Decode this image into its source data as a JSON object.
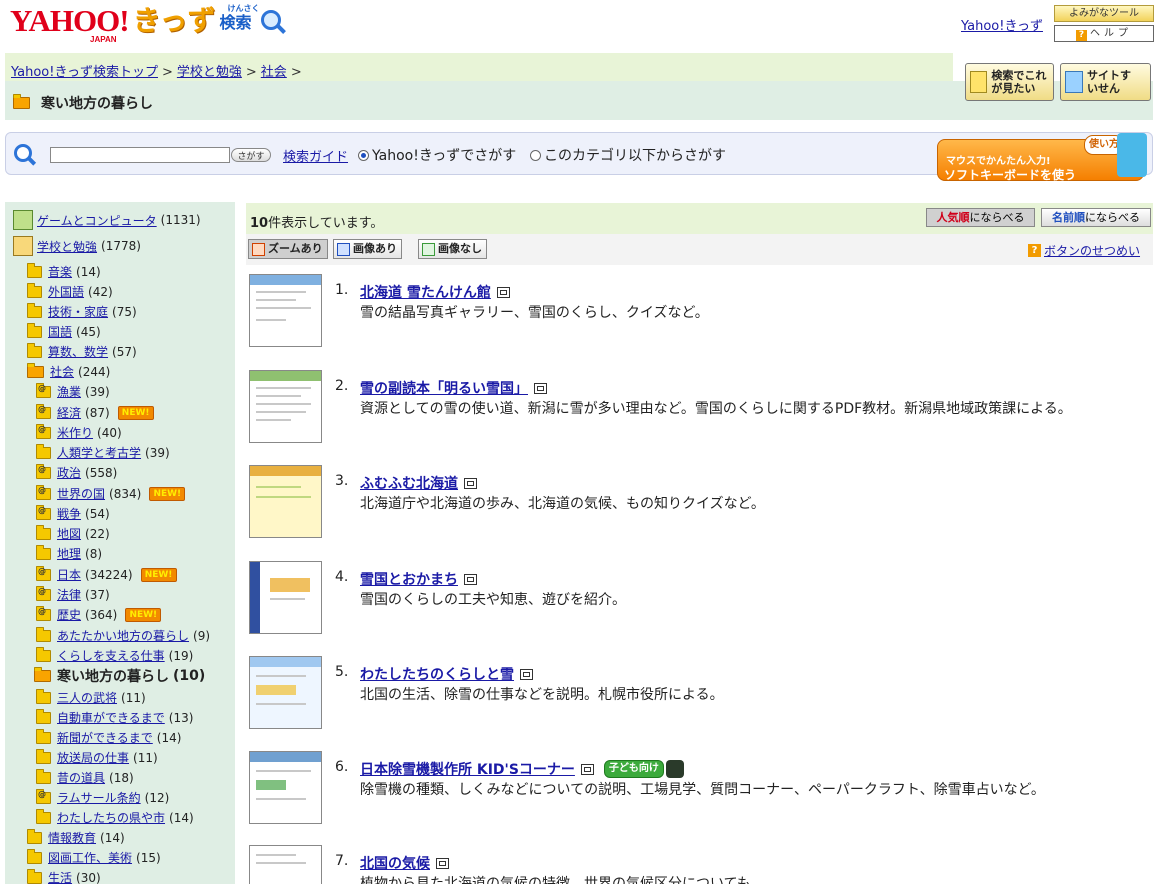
{
  "header": {
    "logo_yahoo": "YAHOO!",
    "logo_japan": "JAPAN",
    "logo_kids": "きっず",
    "logo_search_ruby": "けんさく",
    "logo_search": "検索",
    "kids_link": "Yahoo!きっず",
    "yomigana_tool": "よみがなツール",
    "help_label": "ヘルプ",
    "help_mark": "?"
  },
  "breadcrumb": {
    "items": [
      "Yahoo!きっず検索トップ",
      "学校と勉強",
      "社会"
    ],
    "separator": ">"
  },
  "page_title": "寒い地方の暮らし",
  "side_buttons": {
    "want_label": "検索でこれが見たい",
    "recommend_label": "サイトすいせん"
  },
  "search": {
    "input_value": "",
    "button_label": "さがす",
    "guide_link": "検索ガイド",
    "radio_all_label": "Yahoo!きっずでさがす",
    "radio_category_label": "このカテゴリ以下からさがす"
  },
  "keyboard_banner": {
    "line1": "マウスでかんたん入力!",
    "line2": "ソフトキーボードを使う",
    "badge": "使い方"
  },
  "sidebar": {
    "top": [
      {
        "label": "ゲームとコンピュータ",
        "count": "(1131)"
      },
      {
        "label": "学校と勉強",
        "count": "(1778)"
      }
    ],
    "level1": [
      {
        "label": "音楽",
        "count": "(14)"
      },
      {
        "label": "外国語",
        "count": "(42)"
      },
      {
        "label": "技術・家庭",
        "count": "(75)"
      },
      {
        "label": "国語",
        "count": "(45)"
      },
      {
        "label": "算数、数学",
        "count": "(57)"
      },
      {
        "label": "社会",
        "count": "(244)"
      }
    ],
    "level2": [
      {
        "label": "漁業",
        "count": "(39)"
      },
      {
        "label": "経済",
        "count": "(87)",
        "new": "NEW!"
      },
      {
        "label": "米作り",
        "count": "(40)"
      },
      {
        "label": "人類学と考古学",
        "count": "(39)"
      },
      {
        "label": "政治",
        "count": "(558)"
      },
      {
        "label": "世界の国",
        "count": "(834)",
        "new": "NEW!"
      },
      {
        "label": "戦争",
        "count": "(54)"
      },
      {
        "label": "地図",
        "count": "(22)"
      },
      {
        "label": "地理",
        "count": "(8)"
      },
      {
        "label": "日本",
        "count": "(34224)",
        "new": "NEW!"
      },
      {
        "label": "法律",
        "count": "(37)"
      },
      {
        "label": "歴史",
        "count": "(364)",
        "new": "NEW!"
      },
      {
        "label": "あたたかい地方の暮らし",
        "count": "(9)"
      },
      {
        "label": "くらしを支える仕事",
        "count": "(19)"
      }
    ],
    "current": {
      "label": "寒い地方の暮らし",
      "count": "(10)"
    },
    "level2b": [
      {
        "label": "三人の武将",
        "count": "(11)"
      },
      {
        "label": "自動車ができるまで",
        "count": "(13)"
      },
      {
        "label": "新聞ができるまで",
        "count": "(14)"
      },
      {
        "label": "放送局の仕事",
        "count": "(11)"
      },
      {
        "label": "昔の道具",
        "count": "(18)"
      },
      {
        "label": "ラムサール条約",
        "count": "(12)"
      },
      {
        "label": "わたしたちの県や市",
        "count": "(14)"
      }
    ],
    "level1b": [
      {
        "label": "情報教育",
        "count": "(14)"
      },
      {
        "label": "図画工作、美術",
        "count": "(15)"
      },
      {
        "label": "生活",
        "count": "(30)"
      }
    ]
  },
  "results_header": {
    "count_number": "10",
    "count_suffix": "件表示しています。",
    "sort_popular_hl": "人気順",
    "sort_popular_rest": "にならべる",
    "sort_name_hl": "名前順",
    "sort_name_rest": "にならべる",
    "zoom_label": "ズームあり",
    "image_label": "画像あり",
    "noimage_label": "画像なし",
    "button_help": "ボタンのせつめい"
  },
  "results": [
    {
      "num": "1.",
      "title": "北海道 雪たんけん館",
      "desc": "雪の結晶写真ギャラリー、雪国のくらし、クイズなど。"
    },
    {
      "num": "2.",
      "title": "雪の副読本「明るい雪国」",
      "desc": "資源としての雪の使い道、新潟に雪が多い理由など。雪国のくらしに関するPDF教材。新潟県地域政策課による。"
    },
    {
      "num": "3.",
      "title": "ふむふむ北海道",
      "desc": "北海道庁や北海道の歩み、北海道の気候、もの知りクイズなど。"
    },
    {
      "num": "4.",
      "title": "雪国とおかまち",
      "desc": "雪国のくらしの工夫や知恵、遊びを紹介。"
    },
    {
      "num": "5.",
      "title": "わたしたちのくらしと雪",
      "desc": "北国の生活、除雪の仕事などを説明。札幌市役所による。"
    },
    {
      "num": "6.",
      "title": "日本除雪機製作所 KID'Sコーナー",
      "desc": "除雪機の種類、しくみなどについての説明、工場見学、質問コーナー、ペーパークラフト、除雪車占いなど。",
      "badge": "子ども向け"
    },
    {
      "num": "7.",
      "title": "北国の気候",
      "desc": "植物から見た北海道の気候の特徴。世界の気候区分についても。"
    }
  ],
  "colors": {
    "link": "#1a1aa6",
    "accent_red": "#e0001a",
    "sidebar_bg": "#dfeee4",
    "band_bg": "#e8f4d7"
  }
}
